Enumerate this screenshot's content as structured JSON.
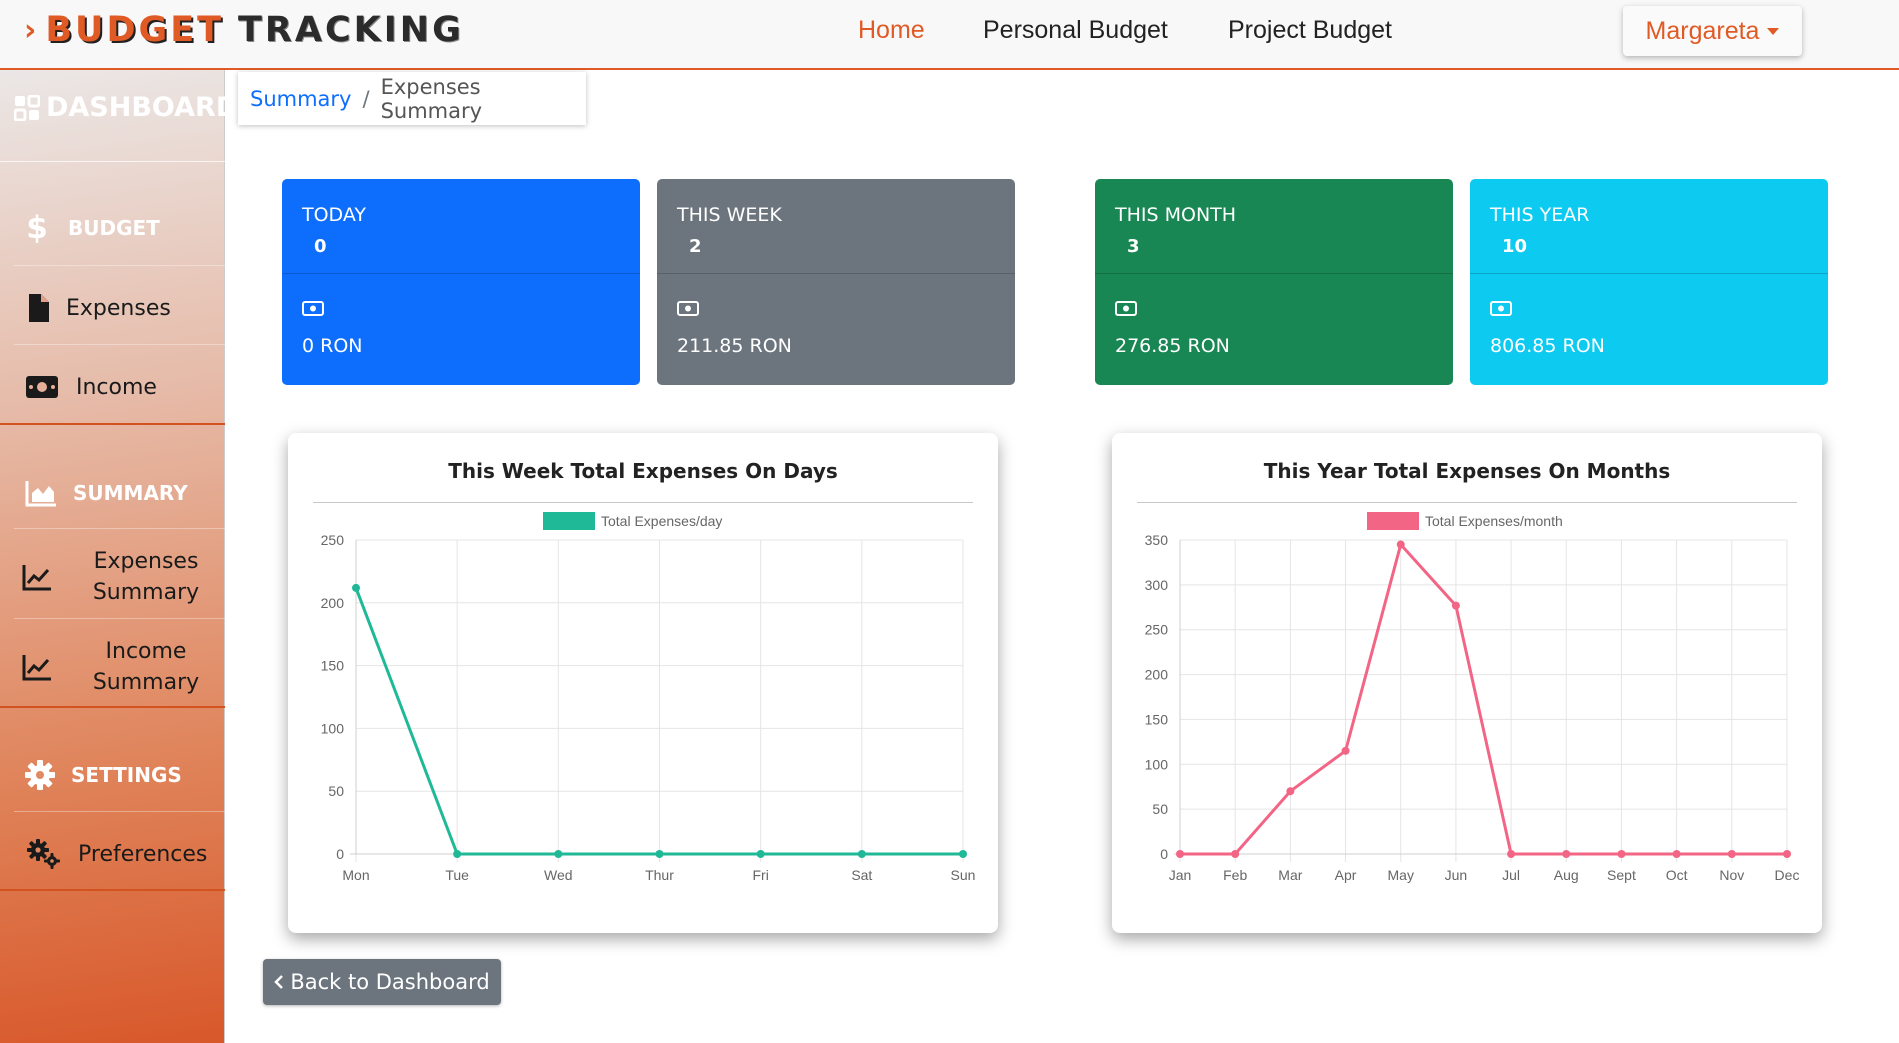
{
  "header": {
    "brand_word1": "BUDGET",
    "brand_word2": "TRACKING",
    "brand_chevron": "›",
    "nav": {
      "home": "Home",
      "personal": "Personal Budget",
      "project": "Project Budget"
    },
    "user": "Margareta"
  },
  "sidebar": {
    "dashboard": "DASHBOARD",
    "budget": "BUDGET",
    "expenses": "Expenses",
    "income": "Income",
    "summary": "SUMMARY",
    "expenses_summary_1": "Expenses",
    "expenses_summary_2": "Summary",
    "income_summary_1": "Income",
    "income_summary_2": "Summary",
    "settings": "SETTINGS",
    "preferences": "Preferences"
  },
  "breadcrumb": {
    "link": "Summary",
    "separator": "/",
    "current": "Expenses Summary"
  },
  "cards": [
    {
      "label": "TODAY",
      "count": "0",
      "amount": "0 RON",
      "color": "#0d6efd"
    },
    {
      "label": "THIS WEEK",
      "count": "2",
      "amount": "211.85 RON",
      "color": "#6c757d"
    },
    {
      "label": "THIS MONTH",
      "count": "3",
      "amount": "276.85 RON",
      "color": "#198754"
    },
    {
      "label": "THIS YEAR",
      "count": "10",
      "amount": "806.85 RON",
      "color": "#0dcaf0"
    }
  ],
  "chart_data": [
    {
      "type": "line",
      "title": "This Week Total Expenses On Days",
      "categories": [
        "Mon",
        "Tue",
        "Wed",
        "Thur",
        "Fri",
        "Sat",
        "Sun"
      ],
      "series": [
        {
          "name": "Total Expenses/day",
          "values": [
            211.85,
            0,
            0,
            0,
            0,
            0,
            0
          ],
          "color": "#20b997"
        }
      ],
      "ylim": [
        0,
        250
      ],
      "yticks": [
        0,
        50,
        100,
        150,
        200,
        250
      ],
      "grid": true,
      "legend": "top"
    },
    {
      "type": "line",
      "title": "This Year Total Expenses On Months",
      "categories": [
        "Jan",
        "Feb",
        "Mar",
        "Apr",
        "May",
        "Jun",
        "Jul",
        "Aug",
        "Sept",
        "Oct",
        "Nov",
        "Dec"
      ],
      "series": [
        {
          "name": "Total Expenses/month",
          "values": [
            0,
            0,
            70,
            115,
            345,
            276.85,
            0,
            0,
            0,
            0,
            0,
            0
          ],
          "color": "#f36585"
        }
      ],
      "ylim": [
        0,
        350
      ],
      "yticks": [
        0,
        50,
        100,
        150,
        200,
        250,
        300,
        350
      ],
      "grid": true,
      "legend": "top"
    }
  ],
  "back_button": "Back to Dashboard",
  "colors": {
    "accent": "#e05a26",
    "link": "#0d6efd"
  }
}
